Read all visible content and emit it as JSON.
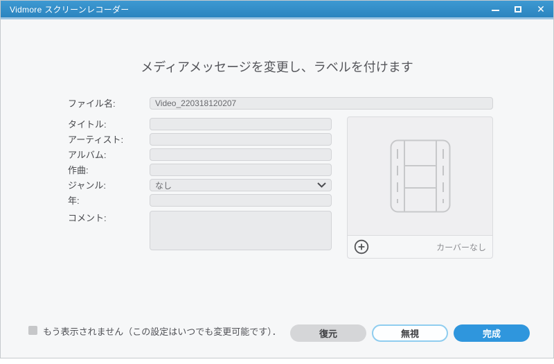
{
  "window": {
    "title": "Vidmore スクリーンレコーダー"
  },
  "heading": "メディアメッセージを変更し、ラベルを付けます",
  "form": {
    "fields": [
      {
        "label": "ファイル名:",
        "value": "Video_220318120207",
        "type": "text"
      },
      {
        "label": "タイトル:",
        "value": "",
        "type": "text"
      },
      {
        "label": "アーティスト:",
        "value": "",
        "type": "text"
      },
      {
        "label": "アルバム:",
        "value": "",
        "type": "text"
      },
      {
        "label": "作曲:",
        "value": "",
        "type": "text"
      },
      {
        "label": "ジャンル:",
        "value": "なし",
        "type": "select"
      },
      {
        "label": "年:",
        "value": "",
        "type": "text"
      },
      {
        "label": "コメント:",
        "value": "",
        "type": "textarea"
      }
    ]
  },
  "cover": {
    "no_cover_label": "カーバーなし",
    "add_icon": "plus-circle-icon",
    "placeholder_icon": "filmstrip-icon"
  },
  "footer": {
    "checkbox_label": "もう表示されません（この設定はいつでも変更可能です）．",
    "restore_label": "復元",
    "ignore_label": "無視",
    "done_label": "完成"
  },
  "colors": {
    "titlebar_blue": "#3090cb",
    "titlebar_underline": "#9cc4e2",
    "accent_blue": "#2f96dd",
    "ignore_border_blue": "#8fcdef",
    "window_bg": "#f6f7f8",
    "field_bg": "#e9eaec",
    "field_border": "#d2d3d6",
    "card_bg": "#efeff1"
  }
}
